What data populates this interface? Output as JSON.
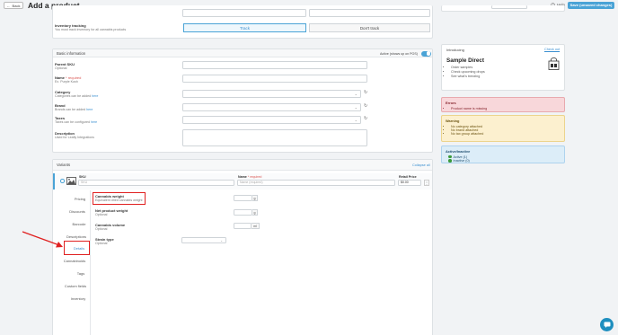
{
  "header": {
    "back_label": "Back",
    "back_arrow": "←",
    "title": "Add a product",
    "help_label": "Help",
    "save_label": "Save (unsaved changes)"
  },
  "inventory": {
    "title": "Inventory tracking",
    "subtitle": "You must track inventory for all cannabis products",
    "track_label": "Track",
    "dont_track_label": "Don't track"
  },
  "basic": {
    "header": "Basic information",
    "active_label": "Active (shows up on POS)",
    "parent_sku": {
      "label": "Parent SKU",
      "sub": "Optional"
    },
    "name": {
      "label": "Name",
      "required": "* required",
      "sub": "Ex. Purple Kush"
    },
    "category": {
      "label": "Category",
      "sub": "Categories can be added",
      "link": "here"
    },
    "brand": {
      "label": "Brand",
      "sub": "Brands can be added",
      "link": "here"
    },
    "taxes": {
      "label": "Taxes",
      "sub": "Taxes can be configured",
      "link": "here"
    },
    "description": {
      "label": "Description",
      "sub": "Used for Leafly Integrations"
    }
  },
  "variants": {
    "header": "Variants",
    "collapse_label": "Collapse all",
    "sku_label": "SKU",
    "sku_placeholder": "SKU",
    "name_label": "Name",
    "name_required": "* required",
    "name_placeholder": "Name (required)",
    "price_label": "Retail Price",
    "price_value": "$0.00",
    "tabs": [
      "Pricing",
      "Discounts",
      "Barcode",
      "Descriptions",
      "Details",
      "Cannabinoids",
      "Tags",
      "Custom fields",
      "Inventory"
    ],
    "fields": {
      "cannabis_weight": {
        "label": "Cannabis weight",
        "sub": "Equivalent dried cannabis weight",
        "unit": "g"
      },
      "net_weight": {
        "label": "Net product weight",
        "sub": "Optional",
        "unit": "g"
      },
      "volume": {
        "label": "Cannabis volume",
        "sub": "Optional",
        "unit": "ml"
      },
      "strain": {
        "label": "Strain type",
        "sub": "Optional"
      }
    }
  },
  "sidebar": {
    "introducing": "Introducing",
    "check_out": "Check out",
    "product_name": "Sample Direct",
    "bullets": [
      "Order samples",
      "Check upcoming drops",
      "See what's trending"
    ]
  },
  "errors": {
    "title": "Errors",
    "items": [
      "Product name is missing"
    ]
  },
  "warnings": {
    "title": "Warning",
    "items": [
      "No category attached",
      "No brand attached",
      "No tax group attached"
    ]
  },
  "active": {
    "title": "Active/Inactive",
    "items": [
      "Active (1)",
      "Inactive (0)"
    ]
  },
  "colors": {
    "accent": "#4aa3d6",
    "highlight": "#e02020",
    "error_bg": "#f8d7da",
    "warning_bg": "#fcf0cf",
    "info_bg": "#dcedf8"
  }
}
